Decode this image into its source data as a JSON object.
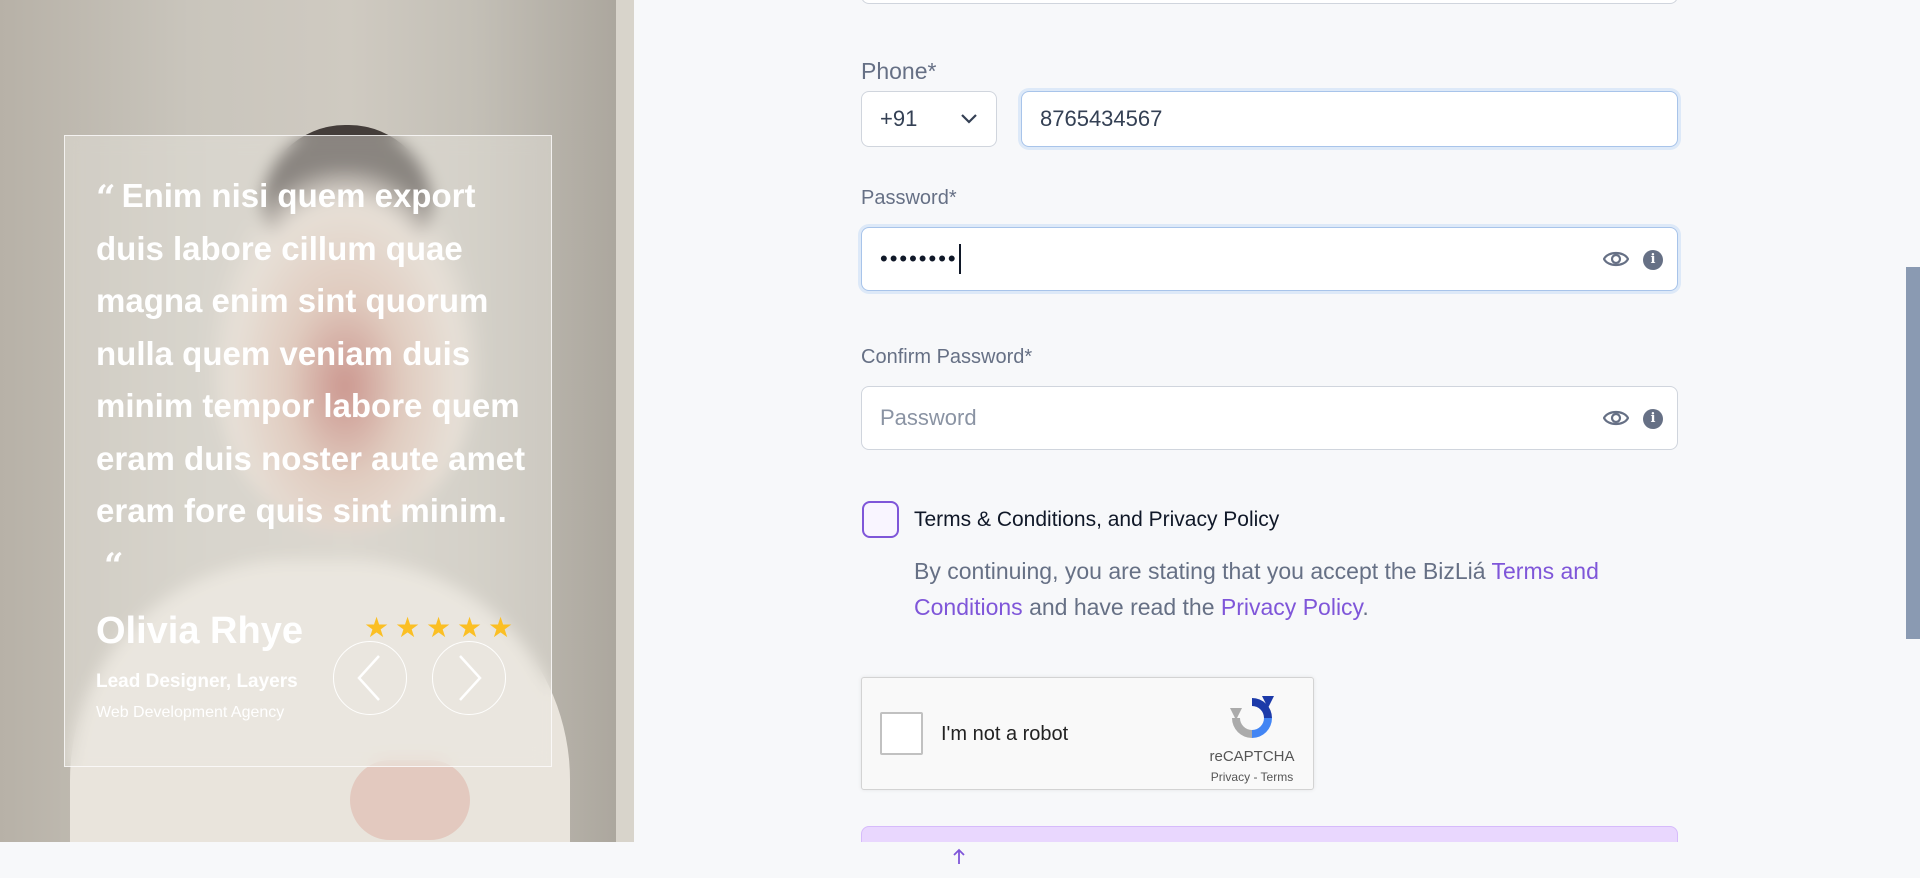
{
  "testimonial": {
    "quote": "Enim nisi quem export duis labore cillum quae magna enim sint quorum nulla quem veniam duis minim tempor labore quem eram duis noster aute amet eram fore quis sint minim.",
    "author_name": "Olivia Rhye",
    "author_role": "Lead Designer, Layers",
    "author_org": "Web Development Agency",
    "rating": 5,
    "star_color": "#fbbf24"
  },
  "form": {
    "phone_label": "Phone*",
    "country_code": "+91",
    "phone_value": "8765434567",
    "password_label": "Password*",
    "password_value": "••••••••",
    "confirm_password_label": "Confirm Password*",
    "confirm_password_placeholder": "Password",
    "terms_checkbox_label": "Terms & Conditions, and Privacy Policy",
    "terms_text_prefix": "By continuing, you are stating that you accept the BizLiá ",
    "terms_link": "Terms and Conditions",
    "terms_text_middle": " and have read the ",
    "privacy_link": "Privacy Policy",
    "terms_text_suffix": "."
  },
  "recaptcha": {
    "label": "I'm not a robot",
    "brand": "reCAPTCHA",
    "links": "Privacy - Terms"
  },
  "colors": {
    "accent": "#7f56d9",
    "submit_bg": "#e9d7fe",
    "label_gray": "#667085"
  },
  "icons": {
    "quote_open": "“",
    "quote_close": "“",
    "prev": "chevron-left-icon",
    "next": "chevron-right-icon",
    "eye": "eye-icon",
    "info": "info-icon",
    "scroll_top": "arrow-up-icon"
  }
}
